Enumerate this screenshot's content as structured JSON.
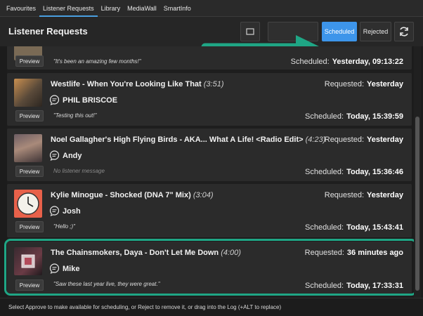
{
  "tabs": [
    "Favourites",
    "Listener Requests",
    "Library",
    "MediaWall",
    "SmartInfo"
  ],
  "active_tab": "Listener Requests",
  "header": {
    "title": "Listener Requests",
    "scheduled_label": "Scheduled",
    "rejected_label": "Rejected"
  },
  "requests": [
    {
      "title": "",
      "duration": "",
      "listener": "",
      "message": "\"It's been an amazing few months!\"",
      "requested_label": "",
      "requested_value": "",
      "scheduled_label": "Scheduled:",
      "scheduled_value": "Yesterday, 09:13:22",
      "preview_label": "Preview"
    },
    {
      "title": "Westlife - When You're Looking Like That",
      "duration": "(3:51)",
      "listener": "PHIL BRISCOE",
      "message": "\"Testing this out!\"",
      "requested_label": "Requested:",
      "requested_value": "Yesterday",
      "scheduled_label": "Scheduled:",
      "scheduled_value": "Today, 15:39:59",
      "preview_label": "Preview"
    },
    {
      "title": "Noel Gallagher's High Flying Birds - AKA... What A Life! <Radio Edit>",
      "duration": "(4:23)",
      "listener": "Andy",
      "message": "No listener message",
      "requested_label": "Requested:",
      "requested_value": "Yesterday",
      "scheduled_label": "Scheduled:",
      "scheduled_value": "Today, 15:36:46",
      "preview_label": "Preview"
    },
    {
      "title": "Kylie Minogue - Shocked (DNA 7\" Mix)",
      "duration": "(3:04)",
      "listener": "Josh",
      "message": "\"Hello ;)\"",
      "requested_label": "Requested:",
      "requested_value": "Yesterday",
      "scheduled_label": "Scheduled:",
      "scheduled_value": "Today, 15:43:41",
      "preview_label": "Preview"
    },
    {
      "title": "The Chainsmokers, Daya - Don't Let Me Down",
      "duration": "(4:00)",
      "listener": "Mike",
      "message": "\"Saw these last year live, they were great.\"",
      "requested_label": "Requested:",
      "requested_value": "36 minutes ago",
      "scheduled_label": "Scheduled:",
      "scheduled_value": "Today, 17:33:31",
      "preview_label": "Preview"
    }
  ],
  "footer": {
    "hint": "Select Approve to make available for scheduling, or Reject to remove it, or drag into the Log (+ALT to replace)"
  },
  "colors": {
    "accent_blue": "#3d95ea",
    "highlight_green": "#1fa685",
    "background": "#1c1c1c",
    "card": "#2b2b2b"
  }
}
